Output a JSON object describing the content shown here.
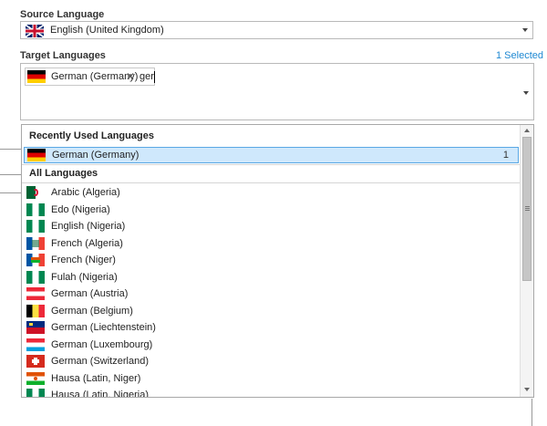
{
  "source": {
    "label": "Source Language",
    "selected": "English (United Kingdom)",
    "flag": "uk-flag-icon"
  },
  "target": {
    "label": "Target Languages",
    "selected_count": "1 Selected",
    "chip_label": "German (Germany)",
    "chip_remove": "✕",
    "input_value": "ger"
  },
  "dropdown": {
    "recent_header": "Recently Used Languages",
    "recent_items": [
      {
        "label": "German (Germany)",
        "count": "1",
        "flag": "de"
      }
    ],
    "all_header": "All Languages",
    "all_items": [
      {
        "label": "Arabic (Algeria)",
        "flag": "dz"
      },
      {
        "label": "Edo (Nigeria)",
        "flag": "ng"
      },
      {
        "label": "English (Nigeria)",
        "flag": "ng"
      },
      {
        "label": "French (Algeria)",
        "flag": "fr-dz"
      },
      {
        "label": "French (Niger)",
        "flag": "fr-ne"
      },
      {
        "label": "Fulah (Nigeria)",
        "flag": "ng"
      },
      {
        "label": "German (Austria)",
        "flag": "at"
      },
      {
        "label": "German (Belgium)",
        "flag": "be"
      },
      {
        "label": "German (Liechtenstein)",
        "flag": "li"
      },
      {
        "label": "German (Luxembourg)",
        "flag": "lu"
      },
      {
        "label": "German (Switzerland)",
        "flag": "ch"
      },
      {
        "label": "Hausa (Latin, Niger)",
        "flag": "ne"
      },
      {
        "label": "Hausa (Latin, Nigeria)",
        "flag": "ng"
      }
    ]
  },
  "colors": {
    "accent": "#1e88d2",
    "selection_bg": "#cfe8fc",
    "selection_border": "#5aa7e4"
  }
}
